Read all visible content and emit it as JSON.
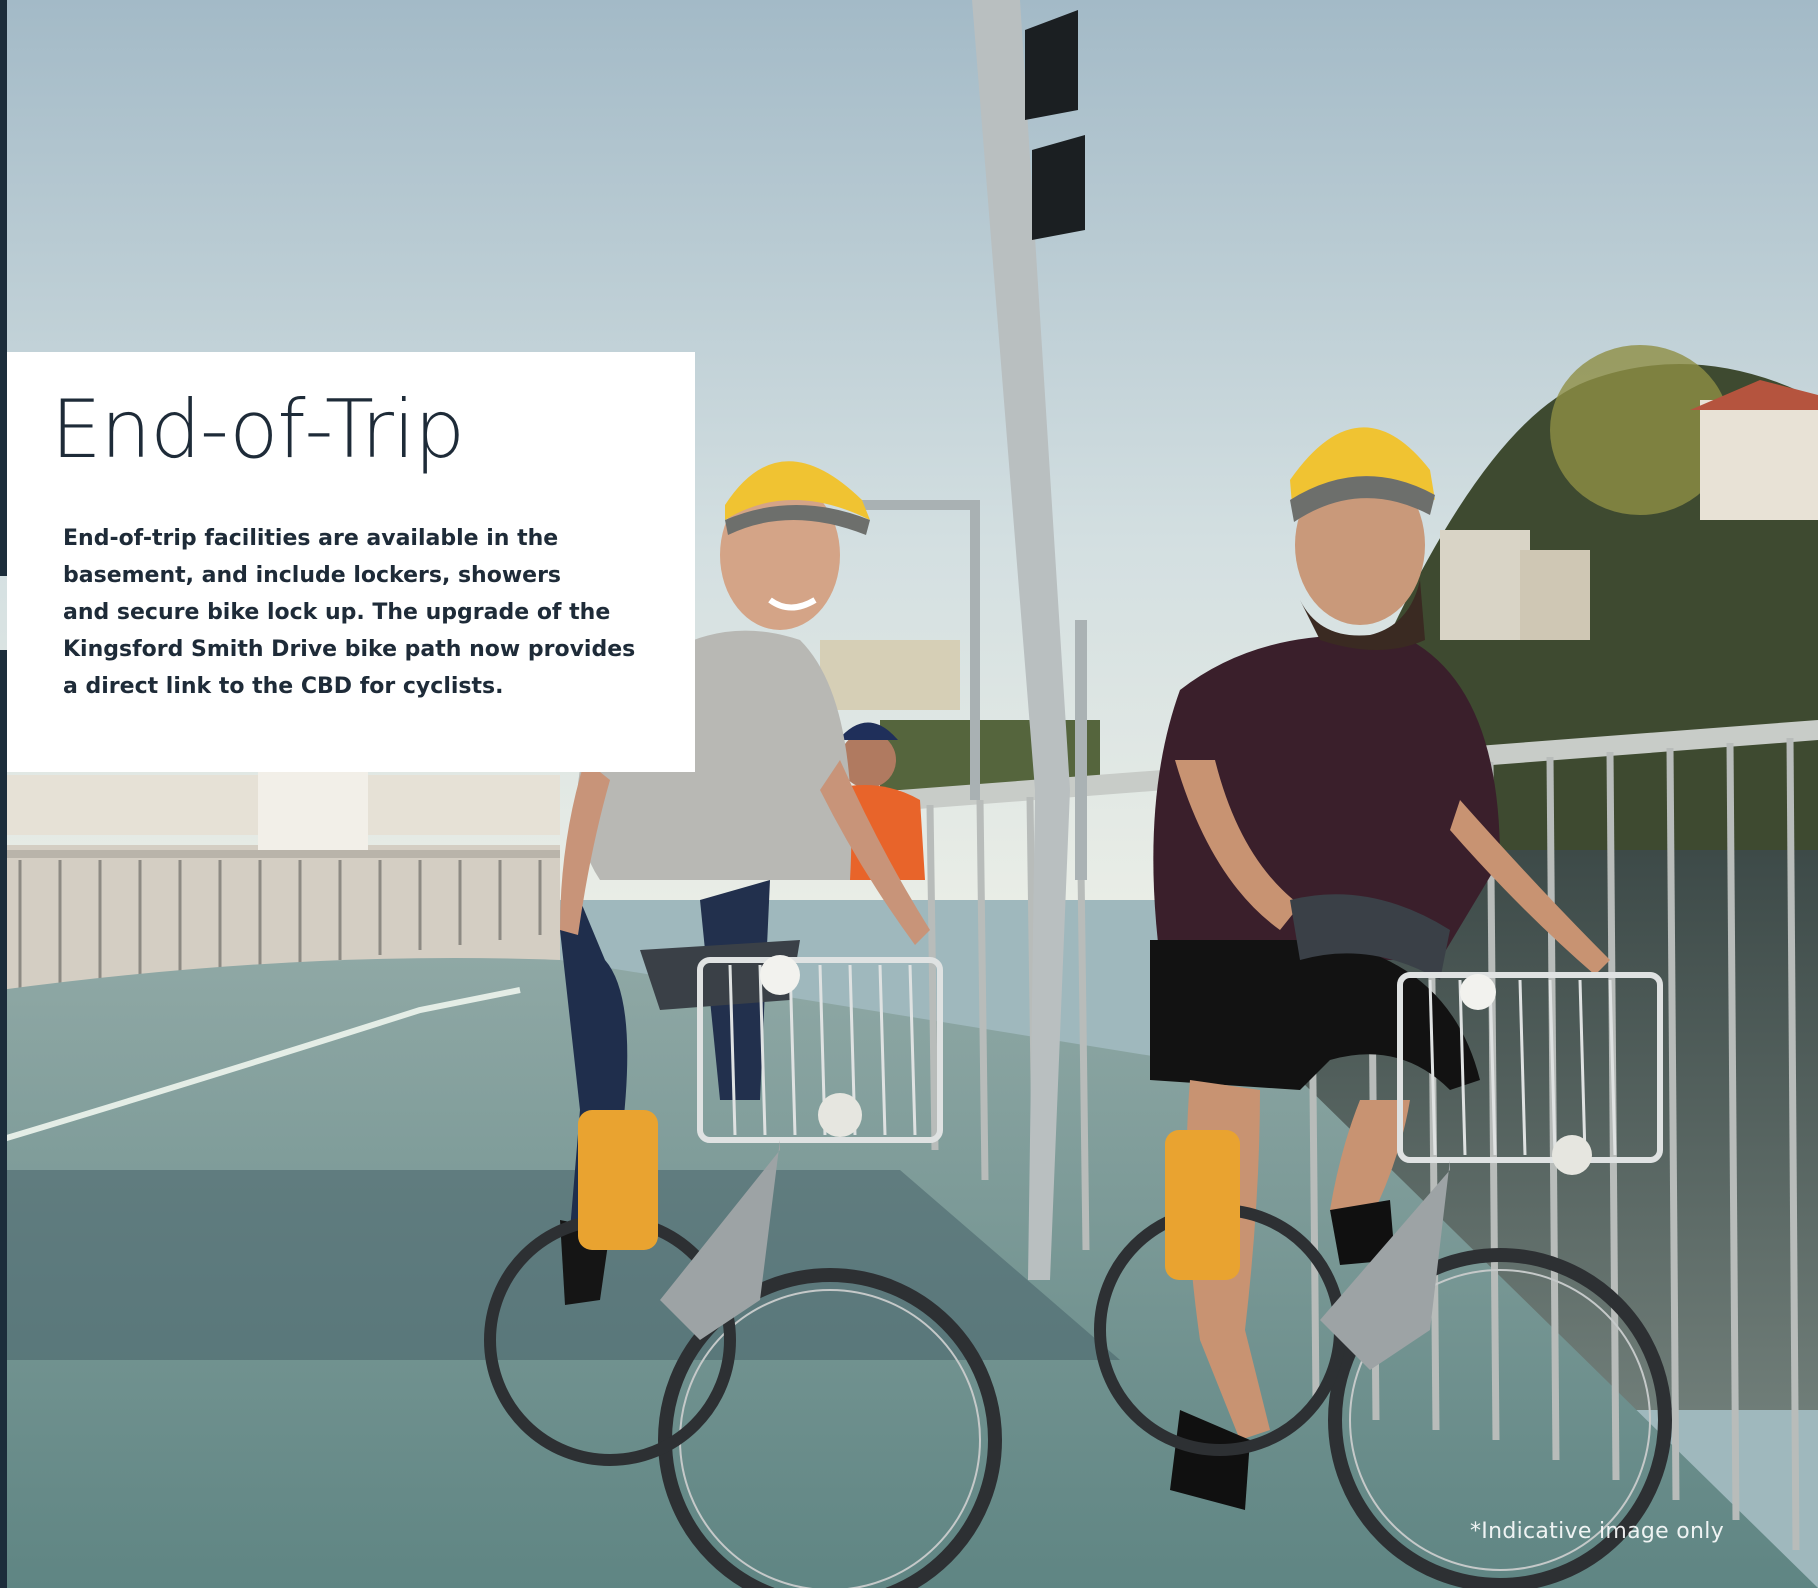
{
  "heading": "End-of-Trip",
  "body_lines": [
    "End-of-trip facilities are available in the",
    "basement, and include lockers, showers",
    "and secure bike lock up. The upgrade of the",
    "Kingsford Smith Drive bike path now provides",
    "a direct link to the CBD for cyclists."
  ],
  "disclaimer": "*Indicative image only",
  "photo": {
    "subject": "three-cyclists-on-riverside-bike-path",
    "colors": {
      "sky_top": "#a6bcc8",
      "sky_bottom": "#dfe7e5",
      "path": "#6f9290",
      "helmet": "#f0c332",
      "accent_navy": "#1c2d3b"
    }
  }
}
